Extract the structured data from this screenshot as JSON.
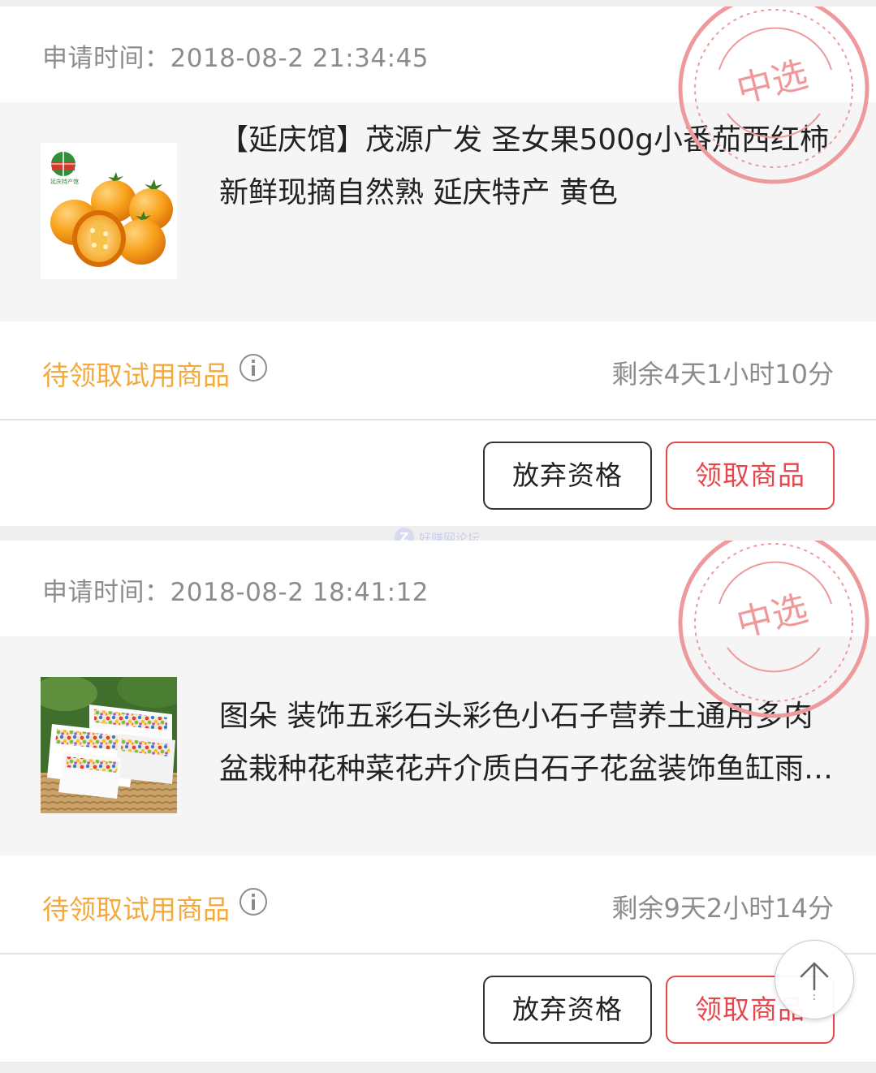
{
  "labels": {
    "apply_time_prefix": "申请时间：",
    "stamp_text": "中选",
    "abandon_button": "放弃资格",
    "claim_button": "领取商品"
  },
  "colors": {
    "stamp_red": "#e5474d",
    "status_orange": "#f4a93c",
    "secondary_text": "#8c8c8c"
  },
  "items": [
    {
      "apply_time": "2018-08-2 21:34:45",
      "title_line1": "【延庆馆】茂源广发 圣女果500g小番茄西红柿",
      "title_line2": "新鲜现摘自然熟 延庆特产 黄色",
      "status": "待领取试用商品",
      "remaining": "剩余4天1小时10分",
      "image_icon": "yellow-cherry-tomatoes-image"
    },
    {
      "apply_time": "2018-08-2 18:41:12",
      "title_line1": "图朵 装饰五彩石头彩色小石子营养土通用多肉",
      "title_line2": "盆栽种花种菜花卉介质白石子花盆装饰鱼缸雨…",
      "status": "待领取试用商品",
      "remaining": "剩余9天2小时14分",
      "image_icon": "colorful-pebbles-image"
    }
  ],
  "watermark": {
    "logo_letter": "Z",
    "text": "好赚网论坛"
  },
  "back_to_top_icon": "arrow-up-icon"
}
